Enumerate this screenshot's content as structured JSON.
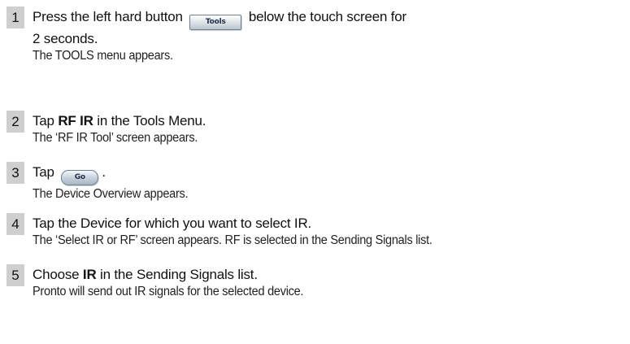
{
  "steps": [
    {
      "number": "1",
      "instruction": {
        "pre": "Press the left hard button",
        "button_label": "Tools",
        "post": "below the touch screen for",
        "line2": "2 seconds."
      },
      "result": "The TOOLS menu appears."
    },
    {
      "number": "2",
      "instruction": {
        "pre": "Tap ",
        "bold": "RF IR",
        "post": " in the Tools Menu."
      },
      "result": "The ‘RF IR Tool’ screen appears."
    },
    {
      "number": "3",
      "instruction": {
        "pre": "Tap",
        "button_label": "Go",
        "post": "."
      },
      "result": "The Device Overview appears."
    },
    {
      "number": "4",
      "instruction": {
        "text": "Tap the Device for which you want to select IR."
      },
      "result": "The ‘Select IR or RF’ screen appears. RF is selected in the Sending Signals list."
    },
    {
      "number": "5",
      "instruction": {
        "pre": "Choose ",
        "bold": "IR",
        "post": " in the Sending Signals list."
      },
      "result": "Pronto will send out IR signals for the selected device."
    }
  ]
}
